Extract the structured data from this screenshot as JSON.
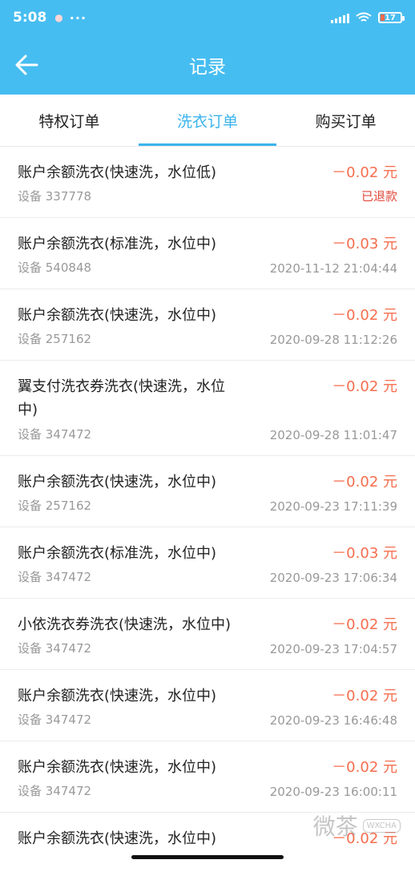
{
  "status_bar": {
    "time": "5:08",
    "dots": "···",
    "battery": "17"
  },
  "header": {
    "title": "记录"
  },
  "tabs": [
    {
      "label": "特权订单",
      "active": false
    },
    {
      "label": "洗衣订单",
      "active": true
    },
    {
      "label": "购买订单",
      "active": false
    }
  ],
  "orders": [
    {
      "name": "账户余额洗衣(快速洗，水位低)",
      "amount": "－0.02 元",
      "device": "设备 337778",
      "status": "已退款"
    },
    {
      "name": "账户余额洗衣(标准洗，水位中)",
      "amount": "－0.03 元",
      "device": "设备 540848",
      "status": "2020-11-12 21:04:44"
    },
    {
      "name": "账户余额洗衣(快速洗，水位中)",
      "amount": "－0.02 元",
      "device": "设备 257162",
      "status": "2020-09-28 11:12:26"
    },
    {
      "name": "翼支付洗衣券洗衣(快速洗，水位中)",
      "amount": "－0.02 元",
      "device": "设备 347472",
      "status": "2020-09-28 11:01:47"
    },
    {
      "name": "账户余额洗衣(快速洗，水位中)",
      "amount": "－0.02 元",
      "device": "设备 257162",
      "status": "2020-09-23 17:11:39"
    },
    {
      "name": "账户余额洗衣(标准洗，水位中)",
      "amount": "－0.03 元",
      "device": "设备 347472",
      "status": "2020-09-23 17:06:34"
    },
    {
      "name": "小依洗衣券洗衣(快速洗，水位中)",
      "amount": "－0.02 元",
      "device": "设备 347472",
      "status": "2020-09-23 17:04:57"
    },
    {
      "name": "账户余额洗衣(快速洗，水位中)",
      "amount": "－0.02 元",
      "device": "设备 347472",
      "status": "2020-09-23 16:46:48"
    },
    {
      "name": "账户余额洗衣(快速洗，水位中)",
      "amount": "－0.02 元",
      "device": "设备 347472",
      "status": "2020-09-23 16:00:11"
    },
    {
      "name": "账户余额洗衣(快速洗，水位中)",
      "amount": "－0.02 元",
      "device": "",
      "status": ""
    }
  ],
  "watermark": {
    "text": "微茶",
    "badge": "WXCHA"
  },
  "colors": {
    "accent": "#46bdf1",
    "amount": "#f56d4d",
    "refunded": "#e14a3c"
  }
}
